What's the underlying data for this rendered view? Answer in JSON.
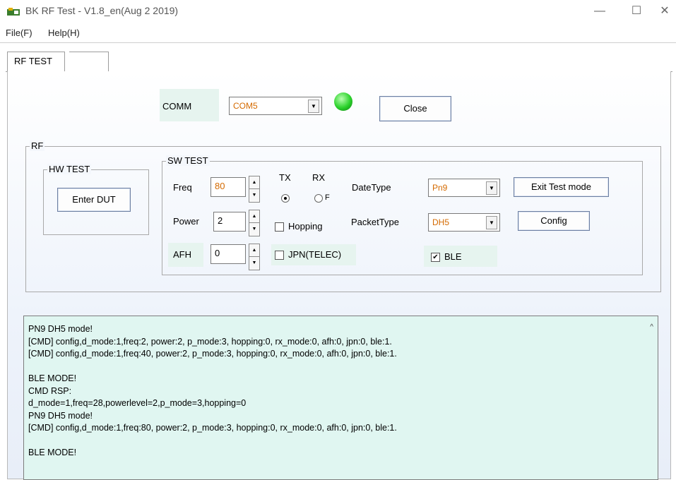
{
  "window": {
    "title": "BK RF Test - V1.8_en(Aug  2 2019)",
    "minimize": "—",
    "maximize": "☐",
    "close": "✕"
  },
  "menu": [
    "File(F)",
    "Help(H)"
  ],
  "tabs": [
    "RF TEST",
    ""
  ],
  "comm": {
    "label": "COMM",
    "port": "COM5",
    "status_color": "#2bd22b",
    "close_button": "Close"
  },
  "rf": {
    "group_label": "RF",
    "hw_test": {
      "label": "HW TEST",
      "enter_dut": "Enter DUT"
    },
    "sw_test": {
      "label": "SW TEST",
      "freq_label": "Freq",
      "freq_value": "80",
      "power_label": "Power",
      "power_value": "2",
      "afh_label": "AFH",
      "afh_value": "0",
      "tx_label": "TX",
      "rx_label": "RX",
      "rx_radio_text": "F",
      "hopping_label": "Hopping",
      "jpn_label": "JPN(TELEC)",
      "datetype_label": "DateType",
      "datetype_value": "Pn9",
      "packettype_label": "PacketType",
      "packettype_value": "DH5",
      "ble_label": "BLE",
      "exit_test_mode": "Exit Test mode",
      "config": "Config"
    }
  },
  "log": {
    "lines": [
      "PN9 DH5 mode!",
      "[CMD] config,d_mode:1,freq:2, power:2, p_mode:3, hopping:0, rx_mode:0, afh:0, jpn:0, ble:1.",
      "[CMD] config,d_mode:1,freq:40, power:2, p_mode:3, hopping:0, rx_mode:0, afh:0, jpn:0, ble:1.",
      "",
      "BLE MODE!",
      "CMD RSP:",
      "d_mode=1,freq=28,powerlevel=2,p_mode=3,hopping=0",
      "PN9 DH5 mode!",
      "[CMD] config,d_mode:1,freq:80, power:2, p_mode:3, hopping:0, rx_mode:0, afh:0, jpn:0, ble:1.",
      "",
      "BLE MODE!"
    ]
  }
}
